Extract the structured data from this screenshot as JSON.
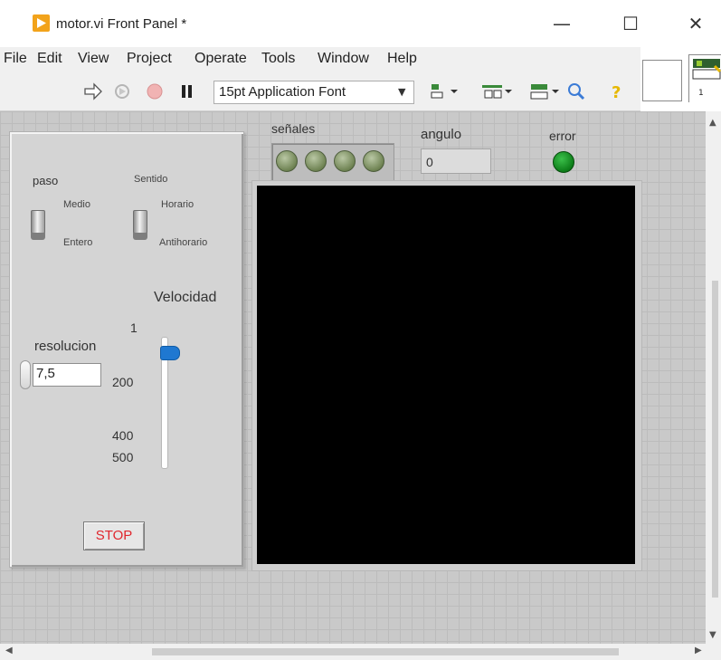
{
  "window": {
    "title": "motor.vi Front Panel *",
    "controls": {
      "minimize": "—",
      "maximize": "☐",
      "close": "✕"
    }
  },
  "menu": [
    "File",
    "Edit",
    "View",
    "Project",
    "Operate",
    "Tools",
    "Window",
    "Help"
  ],
  "toolbar": {
    "font": "15pt Application Font",
    "icons": [
      "run-arrow-icon",
      "run-continuously-icon",
      "abort-icon",
      "pause-icon",
      "align-objects-icon",
      "distribute-objects-icon",
      "resize-objects-icon",
      "reorder-icon",
      "search-icon",
      "context-help-icon"
    ]
  },
  "connector_pane": {
    "label": "1"
  },
  "controls": {
    "paso": {
      "label": "paso",
      "top": "Medio",
      "bottom": "Entero"
    },
    "sentido": {
      "label": "Sentido",
      "top": "Horario",
      "bottom": "Antihorario"
    },
    "velocidad": {
      "label": "Velocidad",
      "ticks": [
        "1",
        "200",
        "400",
        "500"
      ]
    },
    "resolucion": {
      "label": "resolucion",
      "value": "7,5"
    },
    "stop": {
      "label": "STOP"
    }
  },
  "indicators": {
    "senales": {
      "label": "señales",
      "count": 4
    },
    "angulo": {
      "label": "angulo",
      "value": "0"
    },
    "error": {
      "label": "error",
      "color": "#0d7d19"
    }
  },
  "colors": {
    "stop_text": "#e0262d",
    "slider_thumb": "#1f78d1",
    "graph_bg": "#000000"
  }
}
